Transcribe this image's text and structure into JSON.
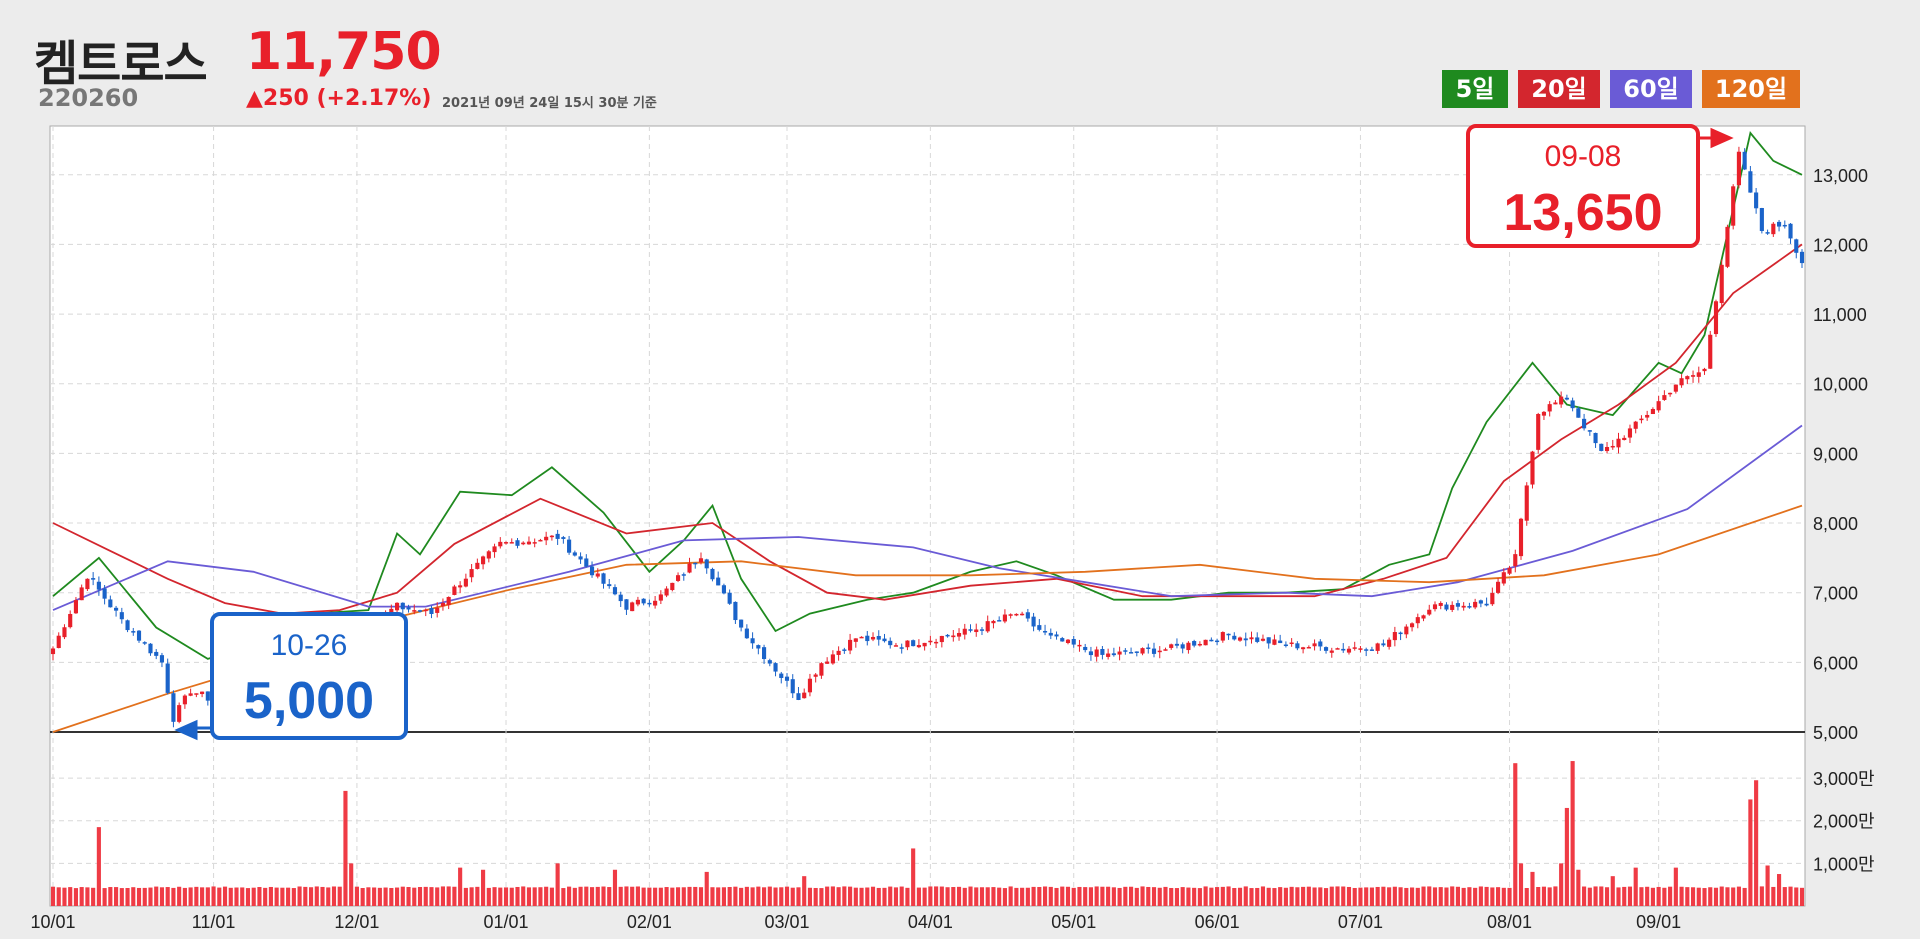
{
  "header": {
    "name": "켐트로스",
    "code": "220260",
    "price": "11,750",
    "change": "▲250 (+2.17%)",
    "timestamp": "2021년 09년 24일 15시 30분 기준"
  },
  "legend": [
    {
      "label": "5일",
      "color": "#1f8a1f"
    },
    {
      "label": "20일",
      "color": "#d3262e"
    },
    {
      "label": "60일",
      "color": "#6a5bd6"
    },
    {
      "label": "120일",
      "color": "#e2711d"
    }
  ],
  "annotations": {
    "high": {
      "date": "09-08",
      "value": "13,650",
      "color": "#e8202a"
    },
    "low": {
      "date": "10-26",
      "value": "5,000",
      "color": "#1a63c9"
    }
  },
  "chart_data": {
    "type": "candlestick",
    "x_ticks": [
      "10/01",
      "11/01",
      "12/01",
      "01/01",
      "02/01",
      "03/01",
      "04/01",
      "05/01",
      "06/01",
      "07/01",
      "08/01",
      "09/01"
    ],
    "price_axis": {
      "ylim": [
        5000,
        13700
      ],
      "ticks": [
        "5,000",
        "6,000",
        "7,000",
        "8,000",
        "9,000",
        "10,000",
        "11,000",
        "12,000",
        "13,000"
      ]
    },
    "volume_axis": {
      "ticks": [
        "1,000만",
        "2,000만",
        "3,000만"
      ],
      "max": 3800
    },
    "up_color": "#e8202a",
    "down_color": "#1a63c9",
    "ma_series": [
      {
        "name": "5일",
        "color": "#1f8a1f",
        "points": [
          [
            0,
            6950
          ],
          [
            8,
            7500
          ],
          [
            18,
            6500
          ],
          [
            27,
            6050
          ],
          [
            35,
            6250
          ],
          [
            45,
            6700
          ],
          [
            55,
            6750
          ],
          [
            60,
            7850
          ],
          [
            64,
            7550
          ],
          [
            71,
            8450
          ],
          [
            80,
            8400
          ],
          [
            87,
            8800
          ],
          [
            96,
            8150
          ],
          [
            104,
            7300
          ],
          [
            110,
            7750
          ],
          [
            115,
            8250
          ],
          [
            120,
            7200
          ],
          [
            126,
            6450
          ],
          [
            132,
            6700
          ],
          [
            142,
            6900
          ],
          [
            150,
            7000
          ],
          [
            160,
            7300
          ],
          [
            168,
            7450
          ],
          [
            175,
            7250
          ],
          [
            185,
            6900
          ],
          [
            195,
            6900
          ],
          [
            205,
            7000
          ],
          [
            215,
            7000
          ],
          [
            225,
            7050
          ],
          [
            233,
            7400
          ],
          [
            240,
            7550
          ],
          [
            244,
            8500
          ],
          [
            250,
            9450
          ],
          [
            258,
            10300
          ],
          [
            264,
            9700
          ],
          [
            272,
            9550
          ],
          [
            280,
            10300
          ],
          [
            284,
            10150
          ],
          [
            288,
            10700
          ],
          [
            296,
            13600
          ],
          [
            300,
            13200
          ],
          [
            305,
            13000
          ]
        ]
      },
      {
        "name": "20일",
        "color": "#d3262e",
        "points": [
          [
            0,
            8000
          ],
          [
            10,
            7600
          ],
          [
            20,
            7200
          ],
          [
            30,
            6850
          ],
          [
            40,
            6700
          ],
          [
            50,
            6750
          ],
          [
            60,
            7000
          ],
          [
            70,
            7700
          ],
          [
            85,
            8350
          ],
          [
            100,
            7850
          ],
          [
            115,
            8000
          ],
          [
            125,
            7450
          ],
          [
            135,
            7000
          ],
          [
            145,
            6900
          ],
          [
            160,
            7100
          ],
          [
            175,
            7200
          ],
          [
            190,
            6950
          ],
          [
            205,
            6950
          ],
          [
            220,
            6950
          ],
          [
            232,
            7200
          ],
          [
            243,
            7500
          ],
          [
            253,
            8600
          ],
          [
            263,
            9200
          ],
          [
            273,
            9700
          ],
          [
            283,
            10300
          ],
          [
            293,
            11300
          ],
          [
            305,
            12000
          ]
        ]
      },
      {
        "name": "60일",
        "color": "#6a5bd6",
        "points": [
          [
            0,
            6750
          ],
          [
            20,
            7450
          ],
          [
            35,
            7300
          ],
          [
            55,
            6800
          ],
          [
            65,
            6800
          ],
          [
            90,
            7300
          ],
          [
            110,
            7750
          ],
          [
            130,
            7800
          ],
          [
            150,
            7650
          ],
          [
            165,
            7350
          ],
          [
            180,
            7150
          ],
          [
            195,
            6950
          ],
          [
            215,
            7000
          ],
          [
            230,
            6950
          ],
          [
            245,
            7150
          ],
          [
            265,
            7600
          ],
          [
            285,
            8200
          ],
          [
            305,
            9400
          ]
        ]
      },
      {
        "name": "120일",
        "color": "#e2711d",
        "points": [
          [
            0,
            5000
          ],
          [
            20,
            5550
          ],
          [
            40,
            6050
          ],
          [
            60,
            6650
          ],
          [
            80,
            7050
          ],
          [
            100,
            7400
          ],
          [
            120,
            7450
          ],
          [
            140,
            7250
          ],
          [
            160,
            7250
          ],
          [
            180,
            7300
          ],
          [
            200,
            7400
          ],
          [
            220,
            7200
          ],
          [
            240,
            7150
          ],
          [
            260,
            7250
          ],
          [
            280,
            7550
          ],
          [
            305,
            8250
          ]
        ]
      }
    ]
  }
}
